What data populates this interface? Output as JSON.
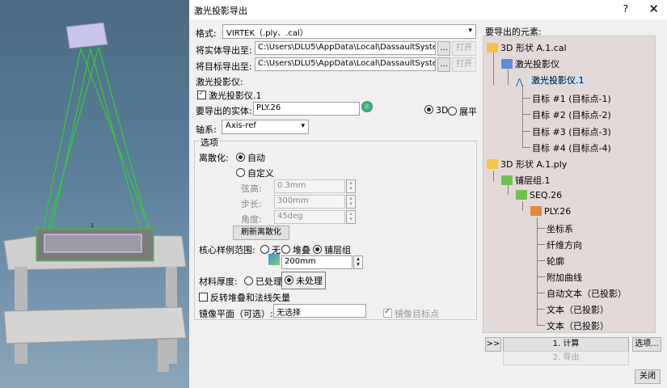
{
  "dialog": {
    "title": "激光投影导出",
    "help": "?",
    "close": "✕"
  },
  "form": {
    "format_label": "格式:",
    "format_value": "VIRTEK（.ply、.cal）",
    "solid_export_label": "将实体导出至:",
    "solid_export_path": "C:\\Users\\DLU5\\AppData\\Local\\DassaultSystemes\\CAT",
    "target_export_label": "将目标导出至:",
    "target_export_path": "C:\\Users\\DLU5\\AppData\\Local\\DassaultSystemes\\CAT",
    "browse_label": "...",
    "open_label": "打开",
    "projector_label": "激光投影仪:",
    "projector_item": "激光投影仪.1",
    "entity_label": "要导出的实体:",
    "entity_value": "PLY.26",
    "mode_3d": "3D",
    "mode_flat": "展平",
    "axis_label": "轴系:",
    "axis_value": "Axis-ref"
  },
  "options": {
    "title": "选项",
    "discretize_label": "离散化:",
    "auto": "自动",
    "custom": "自定义",
    "chord_label": "弦高:",
    "chord_value": "0.3mm",
    "step_label": "步长:",
    "step_value": "300mm",
    "angle_label": "角度:",
    "angle_value": "45deg",
    "refresh_label": "刷新离散化",
    "core_sample_label": "核心样例范围:",
    "core_none": "无",
    "core_stack": "堆叠",
    "core_ply_group": "铺层组",
    "core_value": "200mm",
    "thickness_label": "材料厚度:",
    "thickness_processed": "已处理",
    "thickness_unprocessed": "未处理",
    "reverse_label": "反转堆叠和法线矢量",
    "mirror_label": "镜像平面（可选）:",
    "mirror_value": "无选择",
    "mirror_target_label": "镜像目标点"
  },
  "tree": {
    "header": "要导出的元素:",
    "nodes": [
      "3D 形状 A.1.cal",
      "激光投影仪",
      "激光投影仪.1",
      "目标 #1 (目标点-1)",
      "目标 #2 (目标点-2)",
      "目标 #3 (目标点-3)",
      "目标 #4 (目标点-4)",
      "3D 形状 A.1.ply",
      "铺层组.1",
      "SEQ.26",
      "PLY.26",
      "坐标系",
      "纤维方向",
      "轮廓",
      "附加曲线",
      "自动文本（已投影）",
      "文本（已投影）",
      "文本（已投影）"
    ]
  },
  "footer": {
    "expand": ">>",
    "compute": "1. 计算",
    "options": "选项...",
    "export": "2. 导出",
    "close": "关闭"
  },
  "colors": {
    "viewport_bg": "#5b7f9a",
    "laser_lines": "#2fd02f",
    "tree_bg": "#e4d9d9",
    "projector_box": "#c9c5e8"
  }
}
